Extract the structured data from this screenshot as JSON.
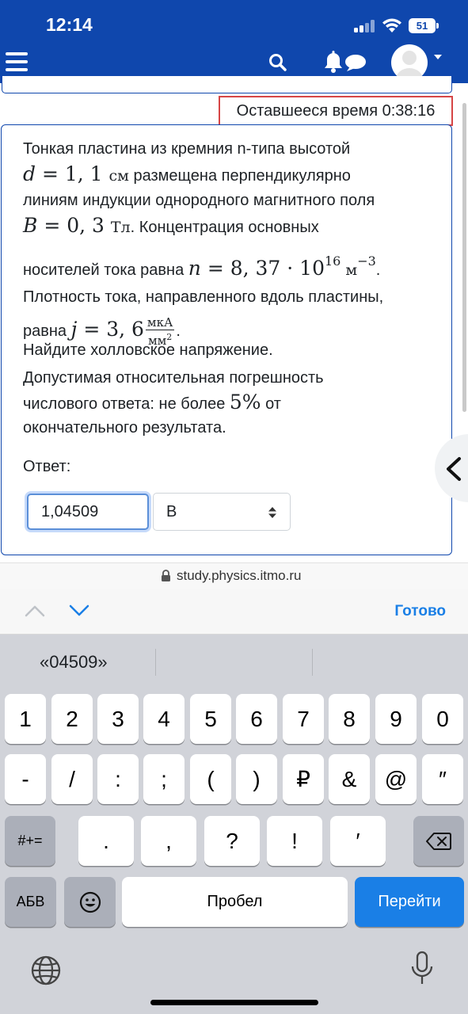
{
  "status_bar": {
    "time": "12:14",
    "battery": "51"
  },
  "header": {
    "menu_icon": "hamburger-icon",
    "search_icon": "search-icon",
    "notifications_icon": "bell-icon",
    "messages_icon": "chat-icon",
    "avatar_icon": "user-avatar"
  },
  "timer": {
    "text": "Оставшееся время 0:38:16"
  },
  "question": {
    "line1": "Тонкая пластина из кремния n-типа высотой",
    "d_var": "d",
    "d_value": " = 1, 1 ",
    "d_unit": "см",
    "line2_rest": " размещена перпендикулярно",
    "line3": "линиям индукции однородного магнитного поля",
    "b_var": "B",
    "b_value": " = 0, 3 ",
    "b_unit": "Тл",
    "line4_rest": ". Концентрация основных",
    "line5_text": "носителей тока равна ",
    "n_var": "n",
    "n_value": " = 8, 37 · 10",
    "n_exp": "16",
    "n_unit": " м",
    "n_unit_exp": "−3",
    "line5_end": ".",
    "line6": "Плотность тока, направленного вдоль пластины,",
    "line7_text": "равна ",
    "j_var": "j",
    "j_value": " = 3, 6",
    "j_unit_num": "мкА",
    "j_unit_den": "мм",
    "j_unit_den_exp": "2",
    "line7_end": ".",
    "task": "Найдите холловское напряжение.",
    "tol_line1": "Допустимая относительная погрешность",
    "tol_text": "числового ответа: не более ",
    "tol_value": "5%",
    "tol_rest": " от",
    "tol_line3": "окончательного результата.",
    "answer_label": "Ответ:",
    "answer_value": "1,04509",
    "unit_selected": "В"
  },
  "browser": {
    "url": "study.physics.itmo.ru"
  },
  "accessory": {
    "done_label": "Готово"
  },
  "keyboard": {
    "suggestion": "«04509»",
    "row1": [
      "1",
      "2",
      "3",
      "4",
      "5",
      "6",
      "7",
      "8",
      "9",
      "0"
    ],
    "row2": [
      "-",
      "/",
      ":",
      ";",
      "(",
      ")",
      "₽",
      "&",
      "@",
      "″"
    ],
    "row3": [
      ".",
      ",",
      "?",
      "!",
      "′"
    ],
    "symbols_key": "#+=",
    "abc_key": "АБВ",
    "space_key": "Пробел",
    "go_key": "Перейти"
  },
  "colors": {
    "header": "#0f47ad",
    "accent": "#1a7fe6",
    "timer_border": "#d64545"
  }
}
